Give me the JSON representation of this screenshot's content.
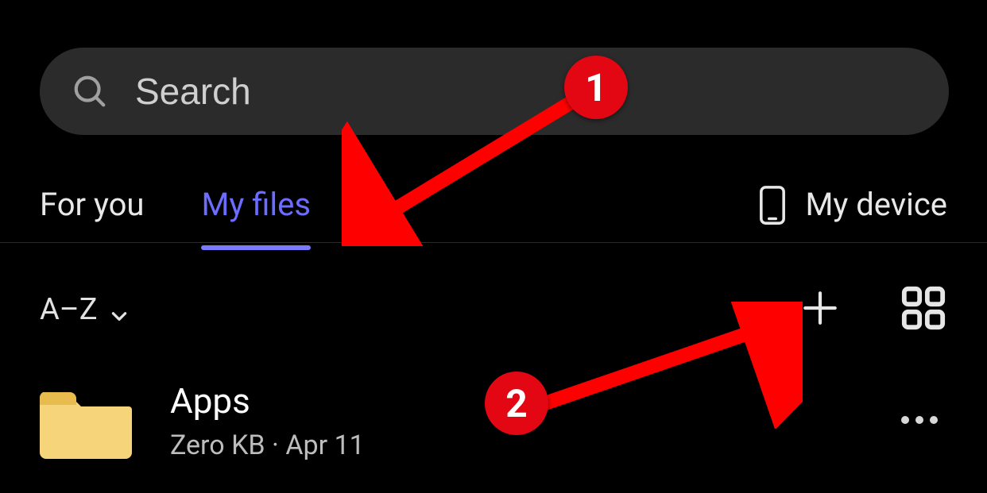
{
  "search": {
    "placeholder": "Search"
  },
  "tabs": {
    "for_you": "For you",
    "my_files": "My files"
  },
  "device": {
    "label": "My device"
  },
  "toolbar": {
    "sort_label": "A–Z"
  },
  "files": [
    {
      "name": "Apps",
      "size": "Zero KB",
      "date": "Apr 11"
    }
  ],
  "annotations": {
    "badge1": "1",
    "badge2": "2"
  }
}
